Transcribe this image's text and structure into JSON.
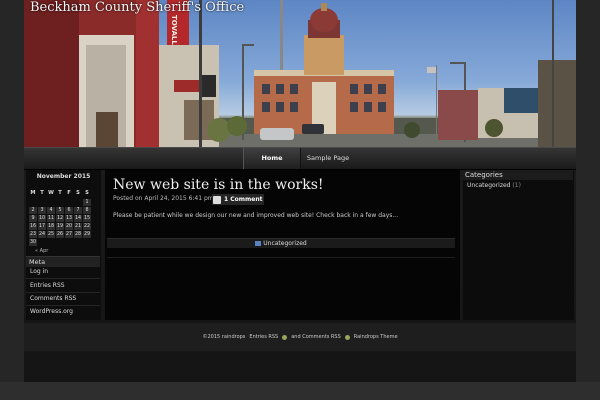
{
  "site": {
    "title": "Beckham County Sheriff's Office"
  },
  "header": {
    "sign_text": "TOVALL"
  },
  "nav": {
    "items": [
      {
        "label": "Home"
      },
      {
        "label": "Sample Page"
      }
    ]
  },
  "calendar": {
    "caption": "November 2015",
    "weekdays": [
      "M",
      "T",
      "W",
      "T",
      "F",
      "S",
      "S"
    ],
    "weeks": [
      [
        "",
        "",
        "",
        "",
        "",
        "",
        "1"
      ],
      [
        "2",
        "3",
        "4",
        "5",
        "6",
        "7",
        "8"
      ],
      [
        "9",
        "10",
        "11",
        "12",
        "13",
        "14",
        "15"
      ],
      [
        "16",
        "17",
        "18",
        "19",
        "20",
        "21",
        "22"
      ],
      [
        "23",
        "24",
        "25",
        "26",
        "27",
        "28",
        "29"
      ],
      [
        "30",
        "",
        "",
        "",
        "",
        "",
        ""
      ]
    ],
    "prev": "« Apr"
  },
  "meta": {
    "title": "Meta",
    "links": [
      "Log in",
      "Entries RSS",
      "Comments RSS",
      "WordPress.org"
    ]
  },
  "post": {
    "title": "New web site is in the works!",
    "meta": "Posted on April 24, 2015 6:41 pm",
    "comments": "1 Comment",
    "excerpt": "Please be patient while we design our new and improved web site! Check back in a few days...",
    "category": "Uncategorized"
  },
  "categories": {
    "title": "Categories",
    "items": [
      {
        "name": "Uncategorized",
        "count": "(1)"
      }
    ]
  },
  "footer": {
    "copyright": "©2015 raindrops",
    "entries_rss": "Entries RSS",
    "and_comments": "and Comments RSS",
    "theme": "Raindrops Theme"
  },
  "colors": {
    "background": "#1c1c1c",
    "accent": "#5a82c0",
    "rss": "#9ba35a"
  }
}
